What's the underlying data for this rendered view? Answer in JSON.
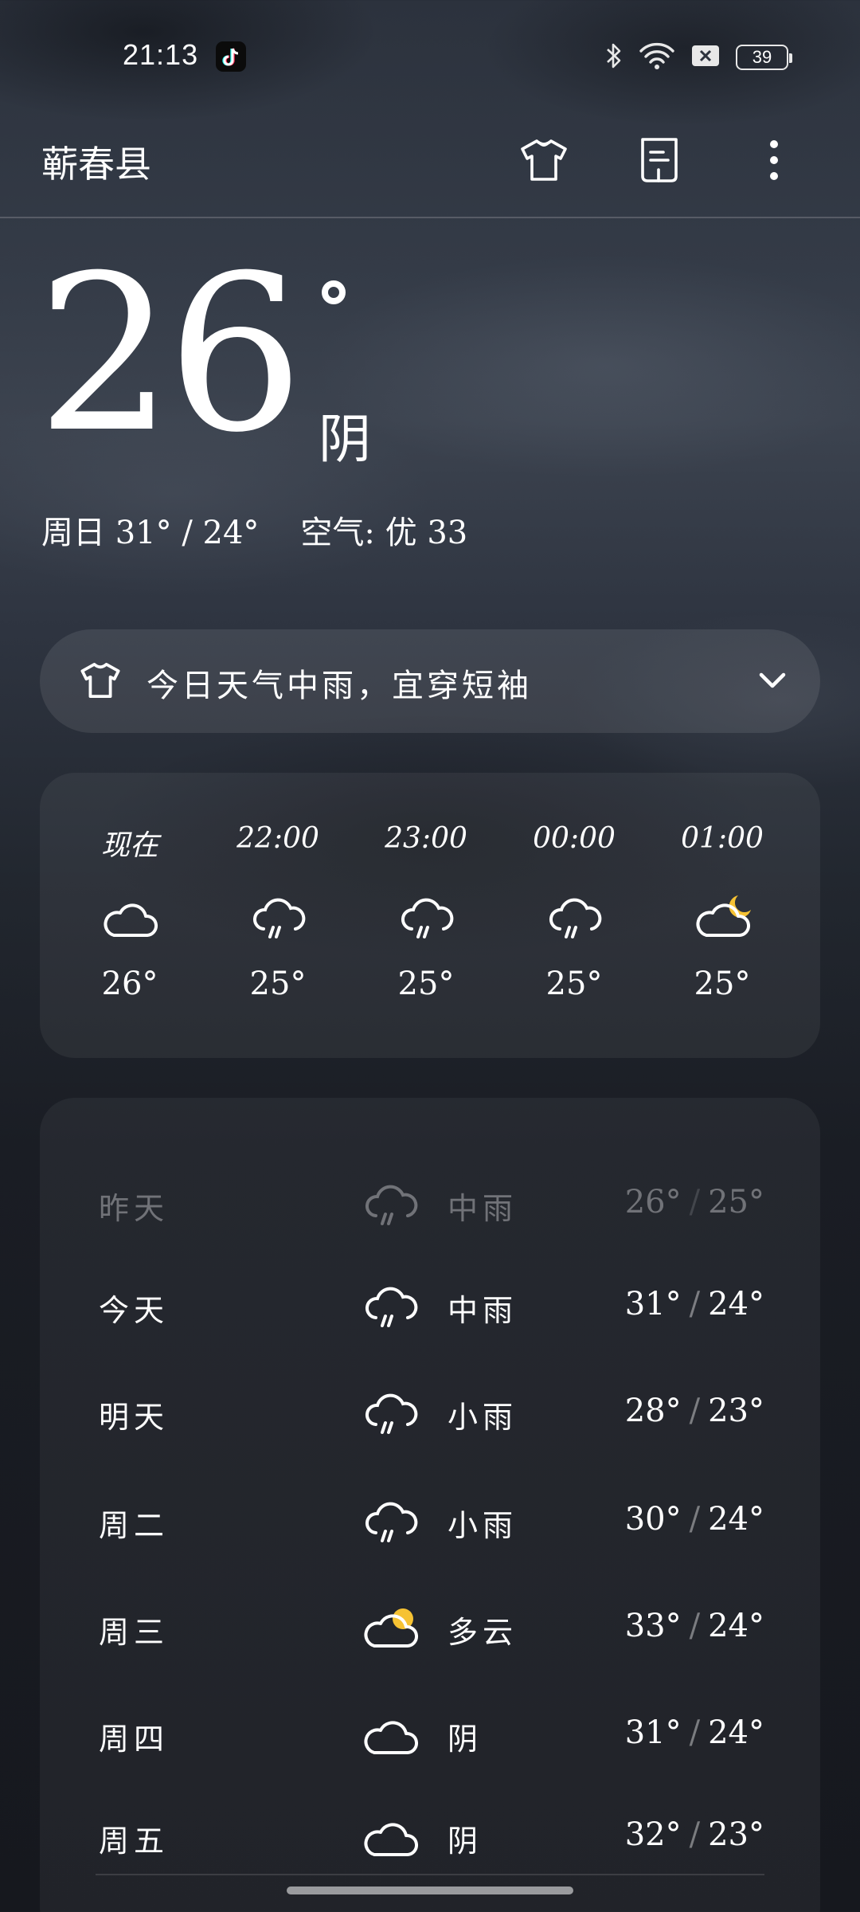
{
  "status_bar": {
    "time": "21:13",
    "battery": "39"
  },
  "header": {
    "city": "蕲春县"
  },
  "current": {
    "temp": "26",
    "condition": "阴",
    "summary": "周日 31° / 24°",
    "air": "空气: 优 33"
  },
  "tip": {
    "text": "今日天气中雨，宜穿短袖"
  },
  "hourly": [
    {
      "time": "现在",
      "icon": "cloudy-icon",
      "temp": "26°"
    },
    {
      "time": "22:00",
      "icon": "rain-icon",
      "temp": "25°"
    },
    {
      "time": "23:00",
      "icon": "rain-icon",
      "temp": "25°"
    },
    {
      "time": "00:00",
      "icon": "rain-icon",
      "temp": "25°"
    },
    {
      "time": "01:00",
      "icon": "partly-cloudy-night-icon",
      "temp": "25°"
    }
  ],
  "daily": [
    {
      "day": "昨天",
      "icon": "rain-icon",
      "condition": "中雨",
      "high": "26°",
      "low": "25°"
    },
    {
      "day": "今天",
      "icon": "rain-icon",
      "condition": "中雨",
      "high": "31°",
      "low": "24°"
    },
    {
      "day": "明天",
      "icon": "rain-icon",
      "condition": "小雨",
      "high": "28°",
      "low": "23°"
    },
    {
      "day": "周二",
      "icon": "rain-icon",
      "condition": "小雨",
      "high": "30°",
      "low": "24°"
    },
    {
      "day": "周三",
      "icon": "partly-cloudy-day-icon",
      "condition": "多云",
      "high": "33°",
      "low": "24°"
    },
    {
      "day": "周四",
      "icon": "cloudy-icon",
      "condition": "阴",
      "high": "31°",
      "low": "24°"
    },
    {
      "day": "周五",
      "icon": "cloudy-icon",
      "condition": "阴",
      "high": "32°",
      "low": "23°"
    }
  ],
  "colors": {
    "sun": "#f6c233",
    "moon": "#f6c233",
    "text": "#ffffff"
  }
}
